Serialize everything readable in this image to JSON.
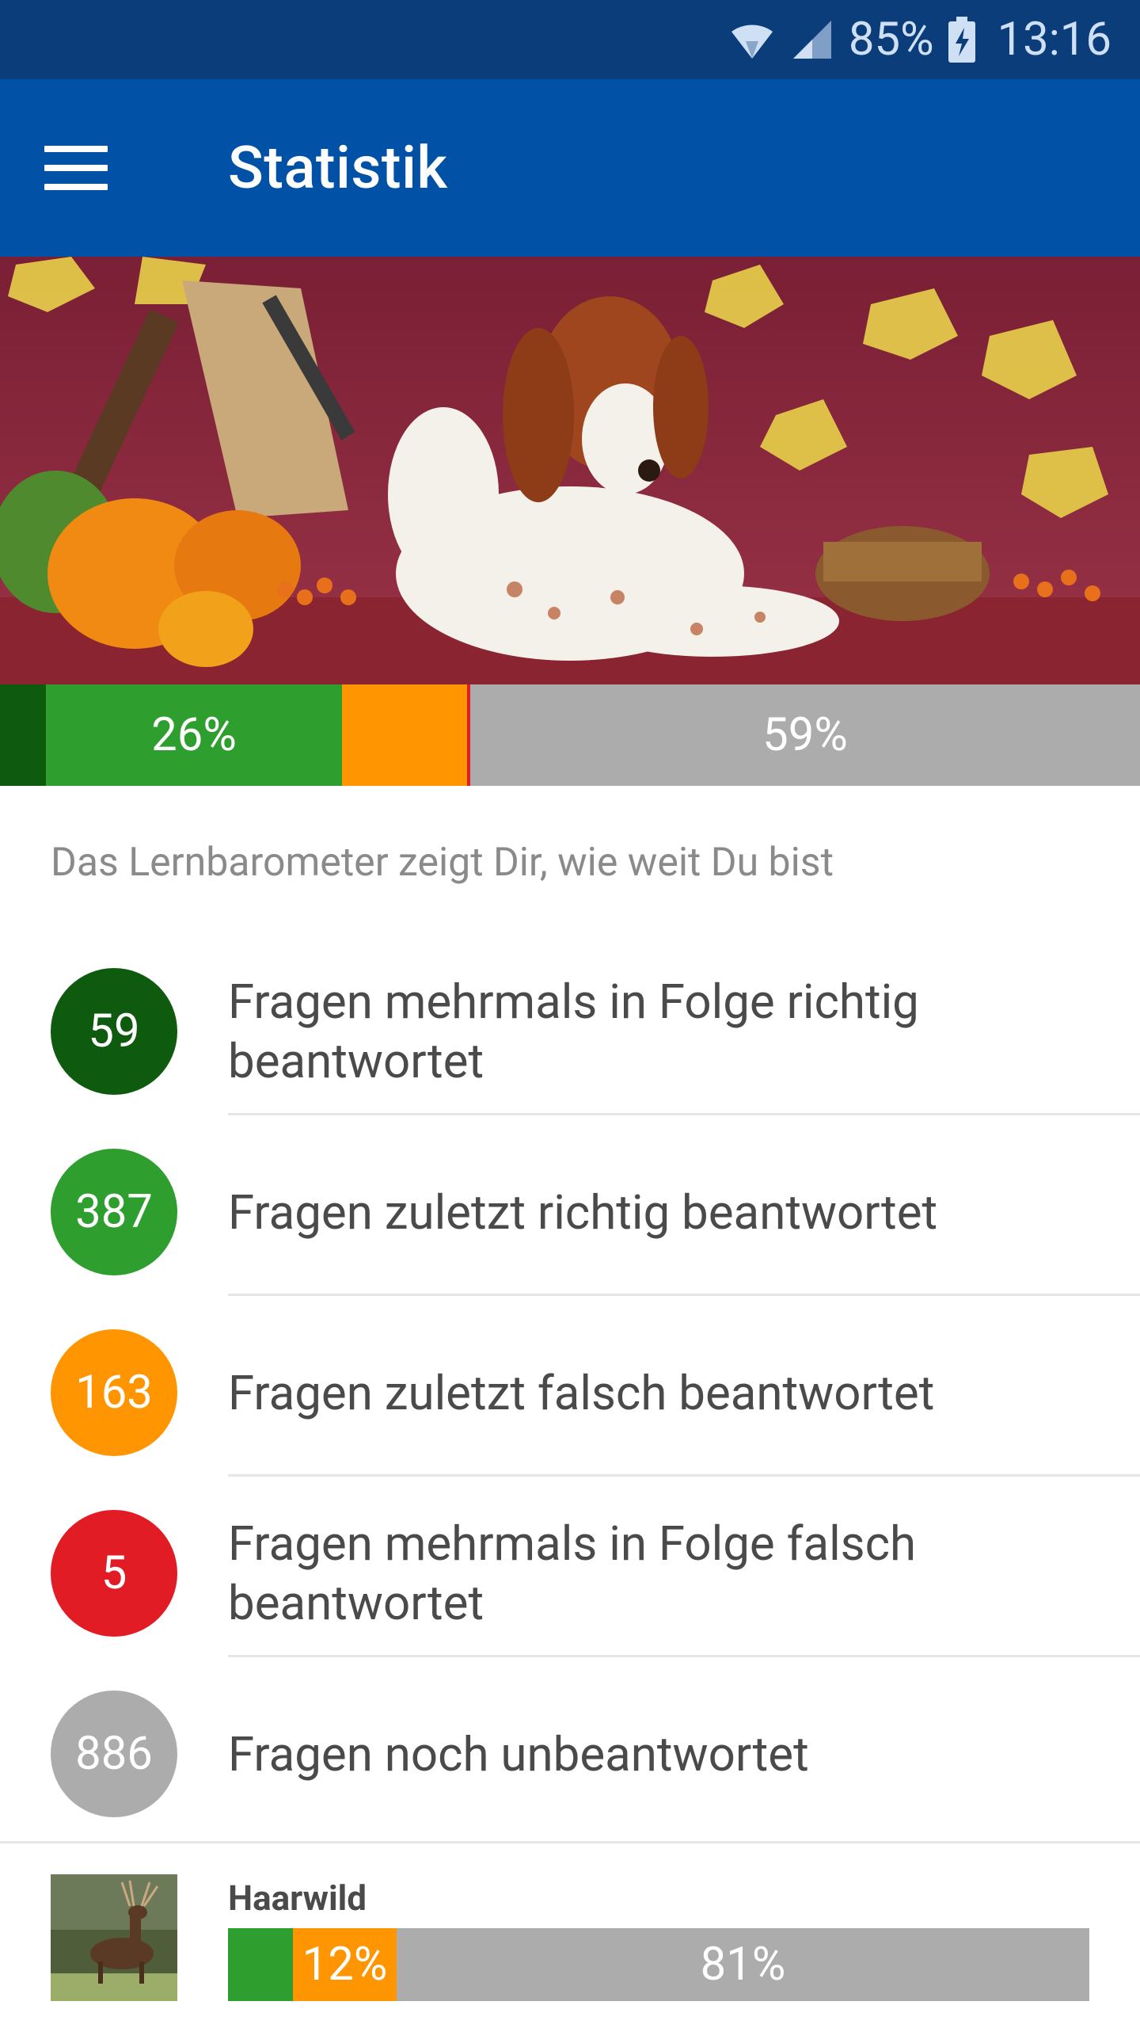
{
  "status_bar": {
    "battery_percent": "85%",
    "time": "13:16",
    "icons": [
      "wifi-icon",
      "signal-icon",
      "battery-charging-icon"
    ]
  },
  "app_bar": {
    "title": "Statistik",
    "menu_icon": "hamburger-menu-icon"
  },
  "hero_image": {
    "description_icon": "hunting-dog-photo"
  },
  "barometer": {
    "segments": [
      {
        "key": "mehrmals_richtig",
        "color": "#0e5a0e",
        "fraction": 0.04,
        "label": ""
      },
      {
        "key": "zuletzt_richtig",
        "color": "#2e9e2e",
        "fraction": 0.26,
        "label": "26%"
      },
      {
        "key": "zuletzt_falsch",
        "color": "#ff9500",
        "fraction": 0.11,
        "label": ""
      },
      {
        "key": "mehrmals_falsch",
        "color": "#e21c24",
        "fraction": 0.003,
        "label": ""
      },
      {
        "key": "unbeantwortet",
        "color": "#acacac",
        "fraction": 0.587,
        "label": "59%"
      }
    ]
  },
  "hint_text": "Das Lernbarometer zeigt Dir, wie weit Du bist",
  "legend": [
    {
      "count": "59",
      "color": "#0e5a0e",
      "label": "Fragen mehrmals in Folge richtig beantwortet"
    },
    {
      "count": "387",
      "color": "#2e9e2e",
      "label": "Fragen zuletzt richtig beantwortet"
    },
    {
      "count": "163",
      "color": "#ff9500",
      "label": "Fragen zuletzt falsch beantwortet"
    },
    {
      "count": "5",
      "color": "#e21c24",
      "label": "Fragen mehrmals in Folge falsch beantwortet"
    },
    {
      "count": "886",
      "color": "#acacac",
      "label": "Fragen noch unbeantwortet"
    }
  ],
  "category": {
    "title": "Haarwild",
    "thumb_icon": "deer-photo",
    "segments": [
      {
        "color": "#2e9e2e",
        "fraction": 0.075,
        "label": ""
      },
      {
        "color": "#ff9500",
        "fraction": 0.12,
        "label": "12%"
      },
      {
        "color": "#acacac",
        "fraction": 0.805,
        "label": "81%"
      }
    ]
  }
}
